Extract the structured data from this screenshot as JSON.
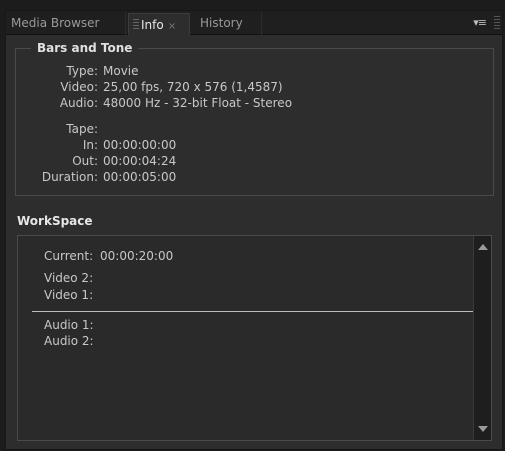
{
  "tabs": {
    "media_browser": "Media Browser",
    "info": "Info",
    "info_close": "×",
    "history": "History",
    "panel_menu": "▾≡"
  },
  "clip": {
    "name": "Bars and Tone",
    "type_label": "Type:",
    "type_value": "Movie",
    "video_label": "Video:",
    "video_value": "25,00 fps, 720 x 576 (1,4587)",
    "audio_label": "Audio:",
    "audio_value": "48000 Hz - 32-bit Float - Stereo",
    "tape_label": "Tape:",
    "tape_value": "",
    "in_label": "In:",
    "in_value": "00:00:00:00",
    "out_label": "Out:",
    "out_value": "00:00:04:24",
    "duration_label": "Duration:",
    "duration_value": "00:00:05:00"
  },
  "workspace": {
    "title": "WorkSpace",
    "current_label": "Current:",
    "current_value": "00:00:20:00",
    "video2_label": "Video 2:",
    "video1_label": "Video 1:",
    "audio1_label": "Audio 1:",
    "audio2_label": "Audio 2:"
  }
}
